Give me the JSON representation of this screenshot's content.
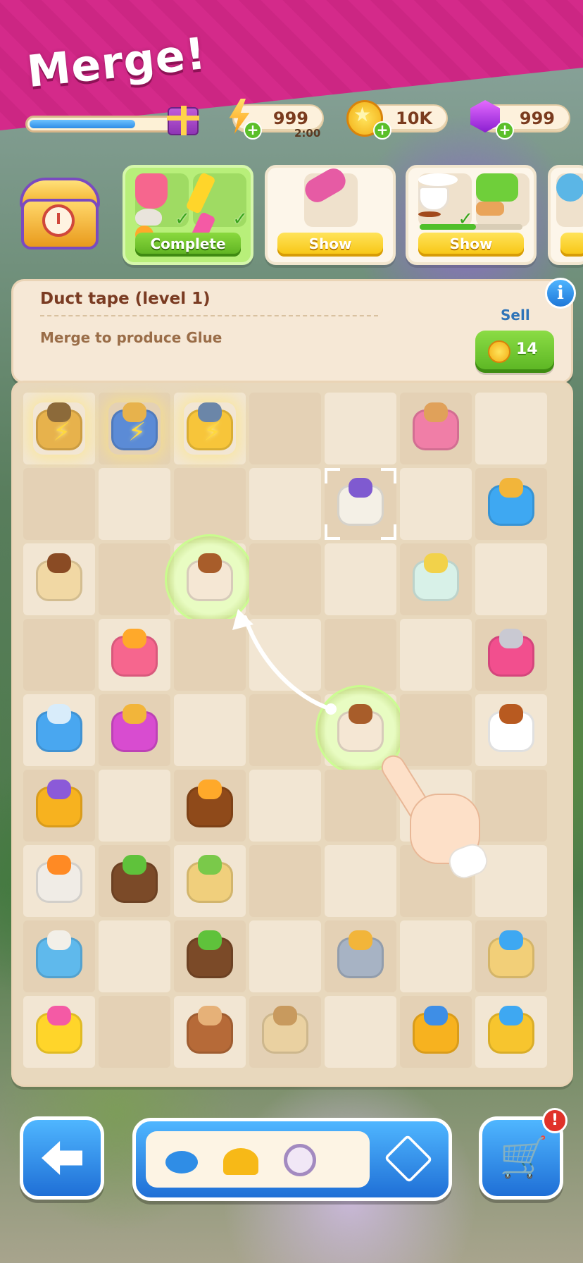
{
  "banner": {
    "title": "Merge!"
  },
  "resources": {
    "energy": {
      "value": "999",
      "timer": "2:00"
    },
    "coins": {
      "value": "10K"
    },
    "gems": {
      "value": "999"
    }
  },
  "orders": [
    {
      "button": "Complete",
      "items": [
        "juicer-icon",
        "highlighter-icon"
      ]
    },
    {
      "button": "Show",
      "items": [
        "pencil-case-icon"
      ]
    },
    {
      "button": "Show",
      "items": [
        "tea-cup-icon",
        "toaster-icon"
      ]
    },
    {
      "button": "",
      "items": [
        "cake-icon"
      ]
    }
  ],
  "info": {
    "title": "Duct tape (level 1)",
    "description": "Merge to produce Glue",
    "sell_label": "Sell",
    "sell_value": "14"
  },
  "board_items": [
    "locked-chest-icon",
    "locked-toolbox-icon",
    "locked-safe-icon",
    "candles-icon",
    "duct-tape-icon",
    "paint-bucket-icon",
    "hot-cocoa-icon",
    "bubble-flower-icon",
    "iced-coffee-icon",
    "espresso-machine-icon",
    "juicer-icon",
    "glue-bottle-icon",
    "pliers-icon",
    "iced-coffee-icon",
    "tea-cup-icon",
    "push-pins-icon",
    "orange-tea-icon",
    "glue-tube-icon",
    "sprout-icon",
    "sand-pile-icon",
    "paint-pail-icon",
    "sprout-icon",
    "handle-icon",
    "sandcastle-icon",
    "highlighter-icon",
    "logs-icon",
    "planks-icon",
    "fish-molds-icon",
    "dump-truck-icon"
  ],
  "inventory": [
    "crab-icon",
    "hard-hat-icon",
    "timer-icon"
  ],
  "shop": {
    "alert": "!"
  },
  "colors": {
    "banner": "#d42a8a",
    "button_yellow": "#f7c40f",
    "button_green": "#5cb020",
    "button_blue": "#1f6fd6",
    "panel": "#f6e8d6"
  }
}
